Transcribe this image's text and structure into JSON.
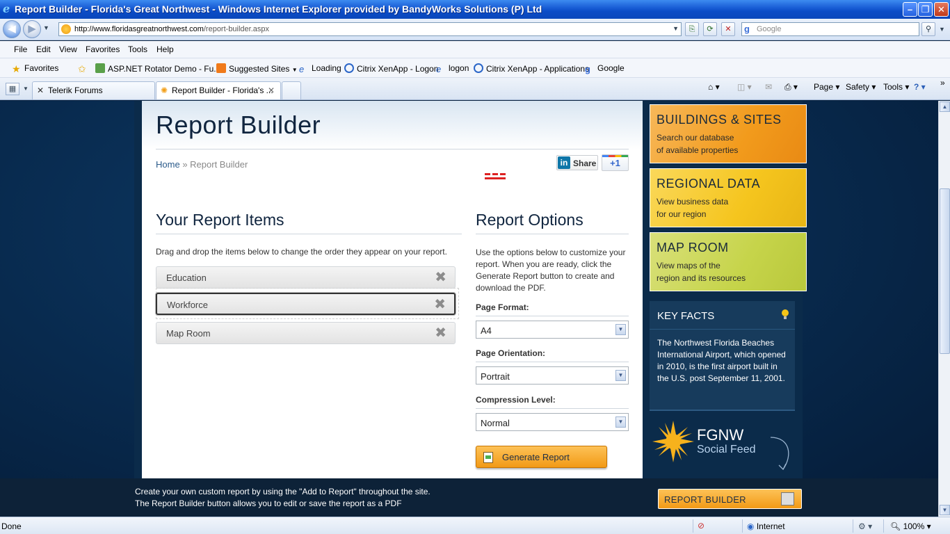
{
  "window": {
    "title": "Report Builder - Florida's Great Northwest - Windows Internet Explorer provided by BandyWorks Solutions (P) Ltd"
  },
  "address": {
    "url_domain": "http://www.floridasgreatnorthwest.com",
    "url_path": "/report-builder.aspx",
    "search_placeholder": "Google"
  },
  "menu": [
    "File",
    "Edit",
    "View",
    "Favorites",
    "Tools",
    "Help"
  ],
  "favorites_bar": {
    "favorites_label": "Favorites",
    "items": [
      "ASP.NET Rotator Demo - Fu...",
      "Suggested Sites",
      "Loading",
      "Citrix XenApp - Logon",
      "logon",
      "Citrix XenApp - Applications",
      "Google"
    ]
  },
  "tabs": [
    "Telerik Forums",
    "Report Builder - Florida's ..."
  ],
  "command_bar": [
    "Page",
    "Safety",
    "Tools"
  ],
  "page": {
    "title": "Report Builder",
    "breadcrumb_home": "Home",
    "breadcrumb_sep": "»",
    "breadcrumb_current": "Report Builder",
    "share_label": "Share",
    "plusone_label": "+1",
    "report_items": {
      "title": "Your Report Items",
      "description": "Drag and drop the items below to change the order they appear on your report.",
      "items": [
        "Education",
        "Workforce",
        "Map Room"
      ]
    },
    "report_options": {
      "title": "Report Options",
      "description": "Use the options below to customize your report. When you are ready, click the Generate Report button to create and download the PDF.",
      "page_format_label": "Page Format:",
      "page_format_value": "A4",
      "page_orientation_label": "Page Orientation:",
      "page_orientation_value": "Portrait",
      "compression_label": "Compression Level:",
      "compression_value": "Normal",
      "generate_label": "Generate Report"
    }
  },
  "sidebar": {
    "buildings": {
      "heading": "BUILDINGS & SITES",
      "line1": "Search our database",
      "line2": "of available properties"
    },
    "regional": {
      "heading": "REGIONAL DATA",
      "line1": "View business data",
      "line2": "for our region"
    },
    "maproom": {
      "heading": "MAP ROOM",
      "line1": "View maps of the",
      "line2": "region and its resources"
    },
    "key_facts": {
      "heading": "KEY FACTS",
      "text": "The Northwest Florida Beaches International Airport, which opened in 2010, is the first airport built in the U.S. post September 11, 2001."
    },
    "social": {
      "heading": "FGNW",
      "sub": "Social Feed"
    }
  },
  "footer": {
    "line1": "Create your own custom report by using the \"Add to Report\" throughout the site.",
    "line2": "The Report Builder button allows you to edit or save the report as a PDF",
    "button_label": "REPORT BUILDER"
  },
  "status": {
    "text": "Done",
    "zone": "Internet",
    "zoom": "100%"
  }
}
